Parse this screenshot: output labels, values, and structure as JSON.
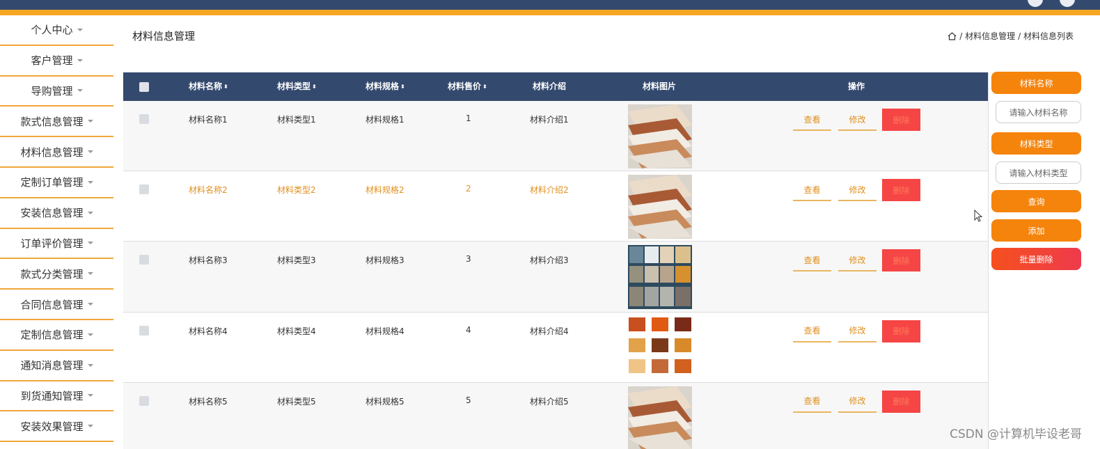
{
  "sidebar": {
    "items": [
      "个人中心",
      "客户管理",
      "导购管理",
      "款式信息管理",
      "材料信息管理",
      "定制订单管理",
      "安装信息管理",
      "订单评价管理",
      "款式分类管理",
      "合同信息管理",
      "定制信息管理",
      "通知消息管理",
      "到货通知管理",
      "安装效果管理"
    ]
  },
  "header": {
    "title": "材料信息管理",
    "breadcrumb": [
      "/ 材料信息管理",
      "/ 材料信息列表"
    ]
  },
  "table": {
    "columns": [
      "材料名称",
      "材料类型",
      "材料规格",
      "材料售价",
      "材料介绍",
      "材料图片",
      "操作"
    ],
    "rows": [
      {
        "name": "材料名称1",
        "type": "材料类型1",
        "spec": "材料规格1",
        "price": "1",
        "intro": "材料介绍1",
        "image": "wood-planks-light"
      },
      {
        "name": "材料名称2",
        "type": "材料类型2",
        "spec": "材料规格2",
        "price": "2",
        "intro": "材料介绍2",
        "image": "wood-planks-light"
      },
      {
        "name": "材料名称3",
        "type": "材料类型3",
        "spec": "材料规格3",
        "price": "3",
        "intro": "材料介绍3",
        "image": "stone-tile-grid"
      },
      {
        "name": "材料名称4",
        "type": "材料类型4",
        "spec": "材料规格4",
        "price": "4",
        "intro": "材料介绍4",
        "image": "wood-swatch-grid"
      },
      {
        "name": "材料名称5",
        "type": "材料类型5",
        "spec": "材料规格5",
        "price": "5",
        "intro": "材料介绍5",
        "image": "wood-planks-light"
      }
    ],
    "actions": {
      "view": "查看",
      "edit": "修改",
      "delete": "删除"
    }
  },
  "search": {
    "name_label": "材料名称",
    "name_placeholder": "请输入材料名称",
    "type_label": "材料类型",
    "type_placeholder": "请输入材料类型",
    "query": "查询",
    "add": "添加",
    "batch_delete": "批量删除"
  },
  "watermark": "CSDN @计算机毕设老哥",
  "colors": {
    "header_bg": "#34496e",
    "accent": "#f5a623",
    "button": "#f5840c",
    "delete": "#f54545",
    "highlight_text": "#e09020"
  }
}
